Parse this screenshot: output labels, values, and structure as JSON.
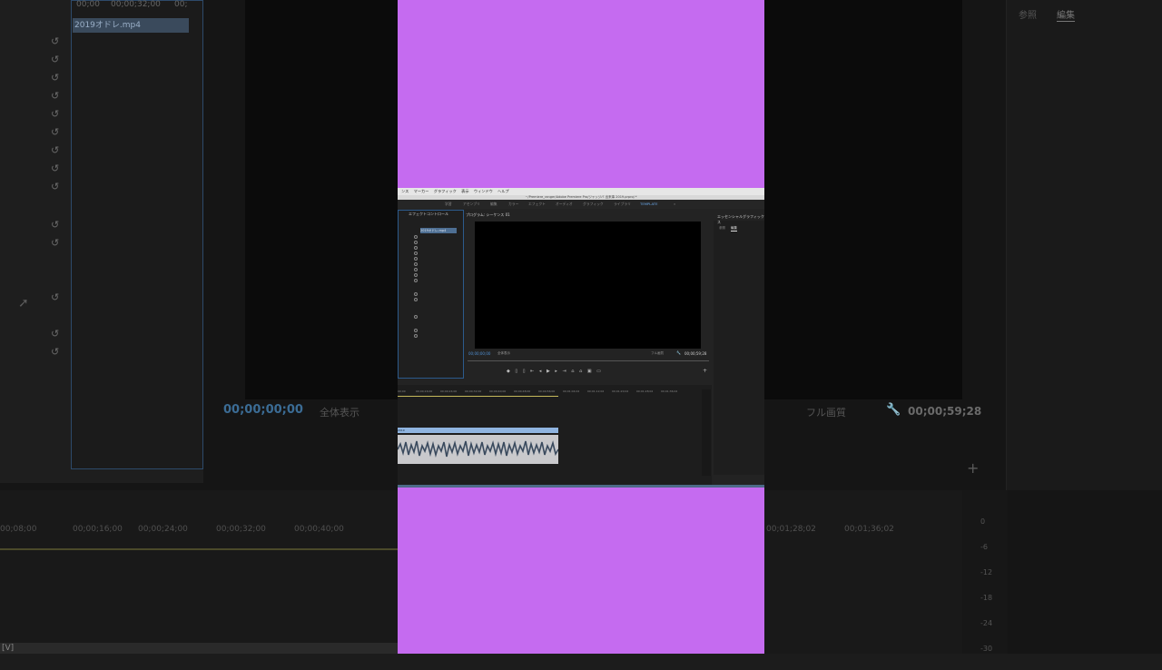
{
  "background": {
    "clip_name": "2019オドレ.mp4",
    "timecode_top_left": "00;00",
    "timecode_top_mid": "00;00;32;00",
    "timecode_top_right": "00;",
    "program_time": "00;00;00;00",
    "zoom_fit": "全体表示",
    "quality": "フル画質",
    "duration": "00;00;59;28",
    "right_tabs": [
      "参照",
      "編集"
    ],
    "ruler_labels": [
      "00;08;00",
      "00;00;16;00",
      "00;00;24;00",
      "00;00;32;00",
      "00;00;40;00",
      "00;01;28;02",
      "00;01;36;02"
    ],
    "meter_labels": [
      "0",
      "-6",
      "-12",
      "-18",
      "-24",
      "-30"
    ],
    "bottom_left_label": "[V]"
  },
  "frame": {
    "menubar_items": [
      "ンス",
      "マーカー",
      "グラフィック",
      "表示",
      "ウィンドウ",
      "ヘルプ"
    ],
    "title_path": "~/Premiere_ranger/Adobe Premiere Pro/ジャッジバ 出来事 2019.prproj *",
    "workspace_tabs": [
      "学習",
      "アセンブリ",
      "編集",
      "カラー",
      "エフェクト",
      "オーディオ",
      "グラフィック",
      "ライブラリ",
      "TEMPLATE",
      "»"
    ],
    "effects_panel_title": "エフェクトコントロール",
    "effects_clip": "2019オドレ.mp4",
    "program_title": "プログラム: シーケンス 01",
    "program_time": "00;00;00;00",
    "zoom_fit": "全体表示",
    "quality": "フル画質",
    "duration": "00;00;59;28",
    "essential_graphics_title": "エッセンシャルグラフィックス",
    "eg_tabs": [
      "参照",
      "編集"
    ],
    "timeline_ruler": [
      "00;00",
      "00;00;16;00",
      "00;00;24;00",
      "00;00;32;00",
      "00;00;40;00",
      "00;00;48;00",
      "00;00;56;00",
      "00;01;04;02",
      "00;01;12;02",
      "00;01;20;02",
      "00;01;28;02",
      "00;01;36;02"
    ],
    "video_clip_label": "2019",
    "transport_glyphs": "◆ ▯ ▯ ⇤ ◂ ▶ ▸ ⇥ ⌂ ⌂ ▣ ▭"
  },
  "colors": {
    "frame_bg": "#c56bf0",
    "accent_blue": "#4e8ed0",
    "timeline_yellow": "#c5b85a"
  }
}
